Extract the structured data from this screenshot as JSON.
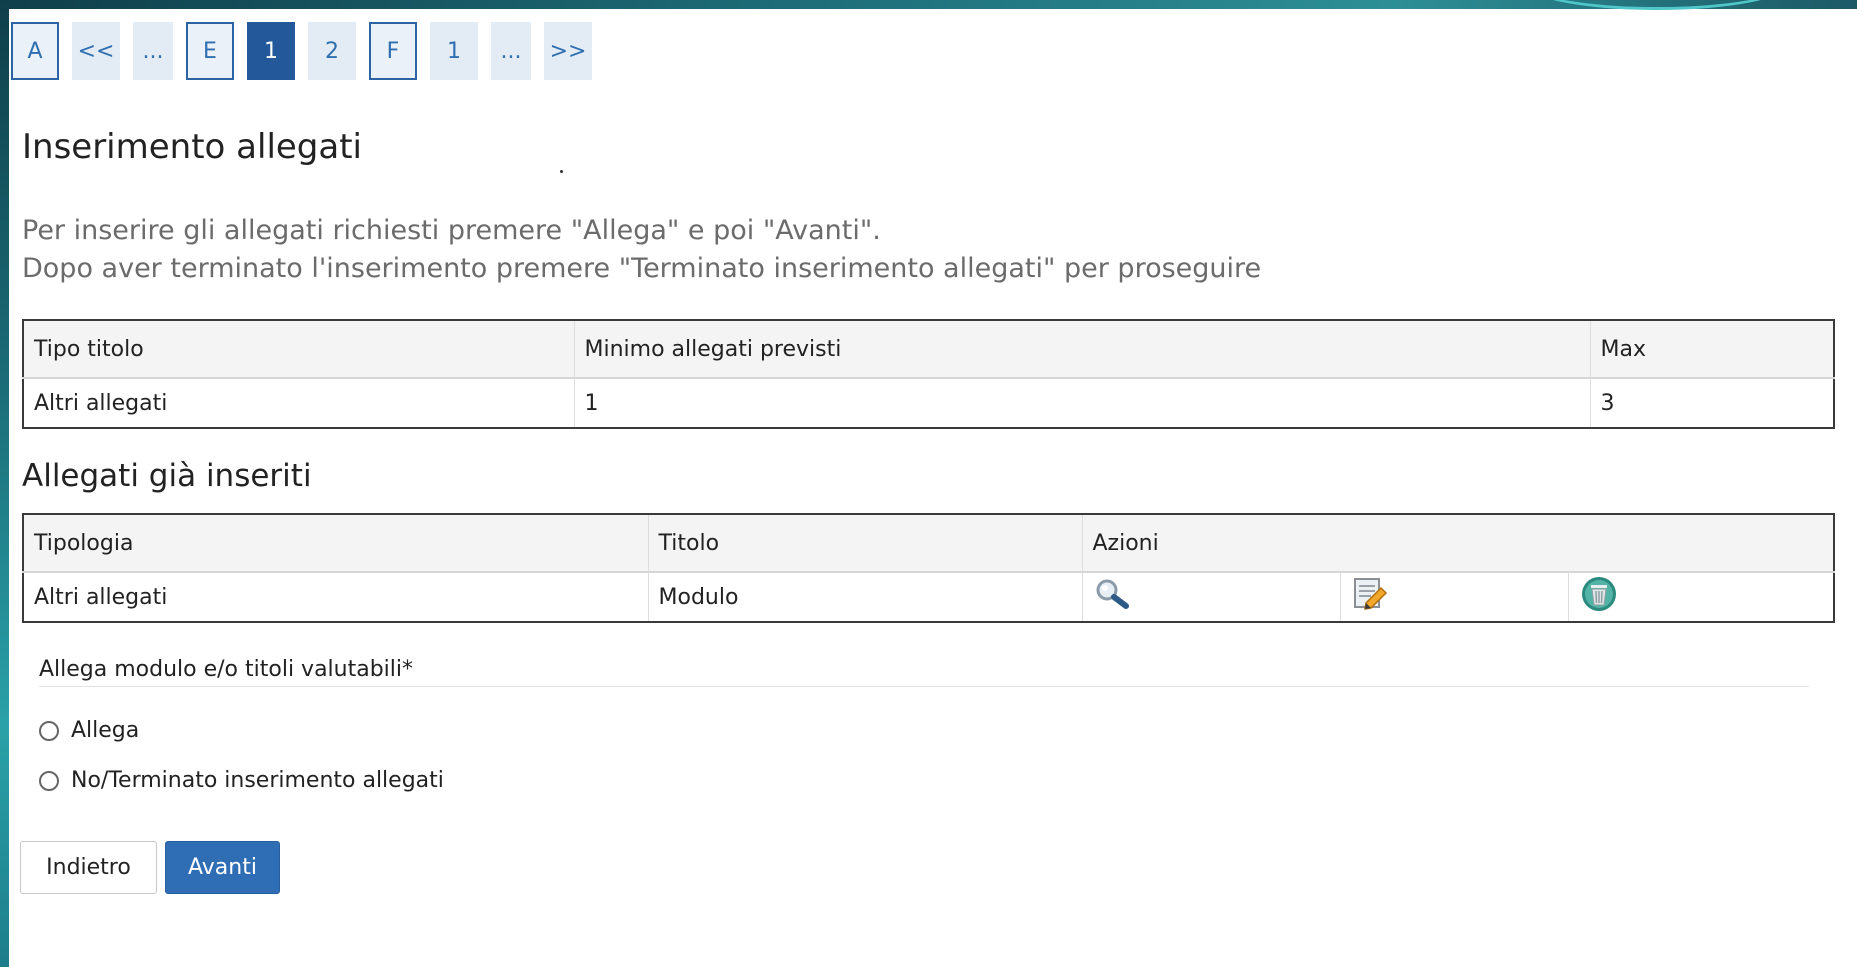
{
  "pagination": {
    "items": [
      {
        "label": "A"
      },
      {
        "label": "<<"
      },
      {
        "label": "..."
      },
      {
        "label": "E"
      },
      {
        "label": "1"
      },
      {
        "label": "2"
      },
      {
        "label": "F"
      },
      {
        "label": "1"
      },
      {
        "label": "..."
      },
      {
        "label": ">>"
      }
    ],
    "active_index": 4
  },
  "page": {
    "title": "Inserimento allegati",
    "intro_line1": "Per inserire gli allegati richiesti premere \"Allega\" e poi \"Avanti\".",
    "intro_line2": "Dopo aver terminato l'inserimento premere \"Terminato inserimento allegati\" per proseguire"
  },
  "requirements_table": {
    "headers": [
      "Tipo titolo",
      "Minimo allegati previsti",
      "Max"
    ],
    "rows": [
      [
        "Altri allegati",
        "1",
        "3"
      ]
    ]
  },
  "attached": {
    "title": "Allegati già inseriti",
    "headers": [
      "Tipologia",
      "Titolo",
      "Azioni"
    ],
    "rows": [
      {
        "tipologia": "Altri allegati",
        "titolo": "Modulo",
        "actions": [
          "view-icon",
          "edit-icon",
          "delete-icon"
        ]
      }
    ]
  },
  "form": {
    "label": "Allega modulo e/o titoli valutabili*",
    "options": [
      "Allega",
      "No/Terminato inserimento allegati"
    ]
  },
  "buttons": {
    "back": "Indietro",
    "next": "Avanti"
  },
  "colors": {
    "accent": "#2f6eb5",
    "pager_active": "#23599a",
    "frame_teal": "#1e6f7a"
  }
}
